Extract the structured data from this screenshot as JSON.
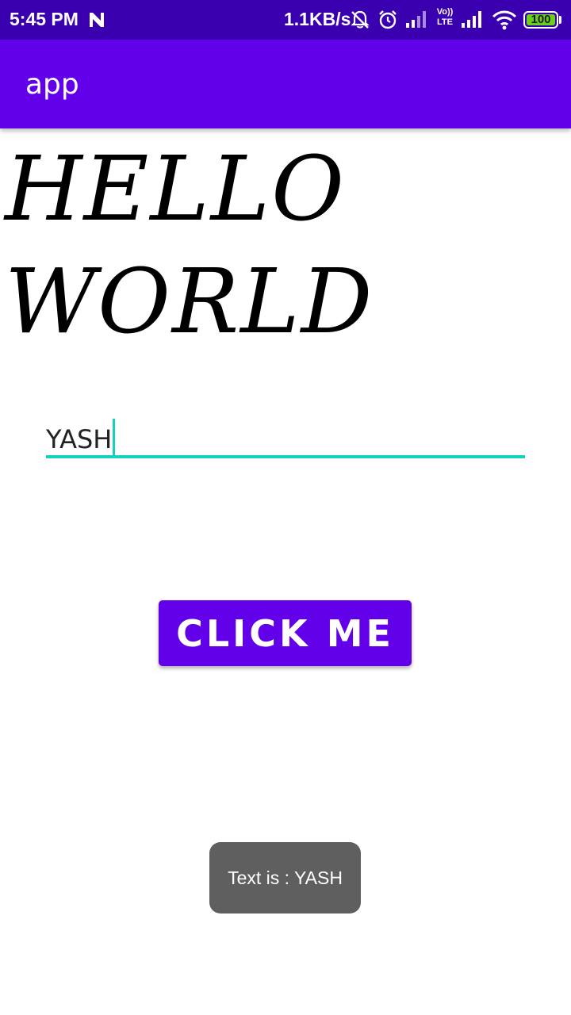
{
  "status_bar": {
    "time": "5:45 PM",
    "net_speed": "1.1KB/s",
    "volte_label_top": "Vo))",
    "volte_label_bottom": "LTE",
    "battery_level": "100",
    "background_color": "#3a00b0",
    "icons": [
      "n-notification-icon",
      "notifications-off-icon",
      "alarm-icon",
      "signal-icon",
      "volte-icon",
      "signal-icon",
      "wifi-icon",
      "battery-icon"
    ]
  },
  "app_bar": {
    "title": "app",
    "background_color": "#6200ea"
  },
  "main": {
    "heading_line1": "HELLO",
    "heading_line2": "WORLD",
    "input_value": "YASH",
    "input_accent_color": "#14d1c4",
    "button_label": "CLICK ME",
    "button_color": "#6200ea"
  },
  "toast": {
    "message": "Text is : YASH"
  }
}
